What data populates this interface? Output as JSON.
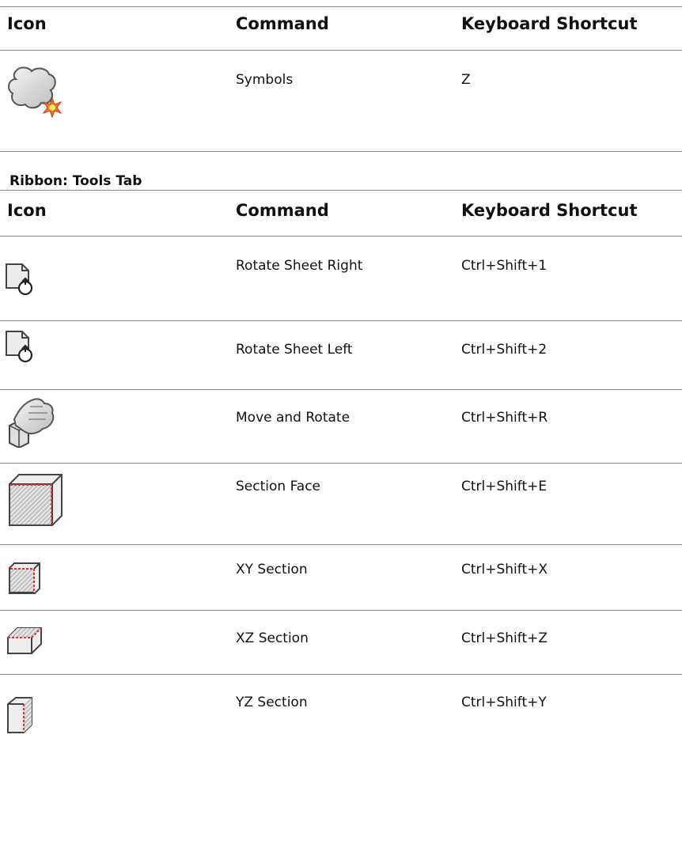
{
  "table1": {
    "headers": {
      "icon": "Icon",
      "command": "Command",
      "shortcut": "Keyboard Shortcut"
    },
    "rows": [
      {
        "icon": "cloud-symbol-icon",
        "command": "Symbols",
        "shortcut": "Z"
      }
    ]
  },
  "section": {
    "title": "Ribbon: Tools Tab"
  },
  "table2": {
    "headers": {
      "icon": "Icon",
      "command": "Command",
      "shortcut": "Keyboard Shortcut"
    },
    "rows": [
      {
        "icon": "rotate-sheet-right-icon",
        "command": "Rotate Sheet Right",
        "shortcut": "Ctrl+Shift+1"
      },
      {
        "icon": "rotate-sheet-left-icon",
        "command": "Rotate Sheet Left",
        "shortcut": "Ctrl+Shift+2"
      },
      {
        "icon": "move-rotate-hand-icon",
        "command": "Move and Rotate",
        "shortcut": "Ctrl+Shift+R"
      },
      {
        "icon": "section-face-icon",
        "command": "Section Face",
        "shortcut": "Ctrl+Shift+E"
      },
      {
        "icon": "xy-section-icon",
        "command": "XY Section",
        "shortcut": "Ctrl+Shift+X"
      },
      {
        "icon": "xz-section-icon",
        "command": "XZ Section",
        "shortcut": "Ctrl+Shift+Z"
      },
      {
        "icon": "yz-section-icon",
        "command": "YZ Section",
        "shortcut": "Ctrl+Shift+Y"
      }
    ]
  }
}
